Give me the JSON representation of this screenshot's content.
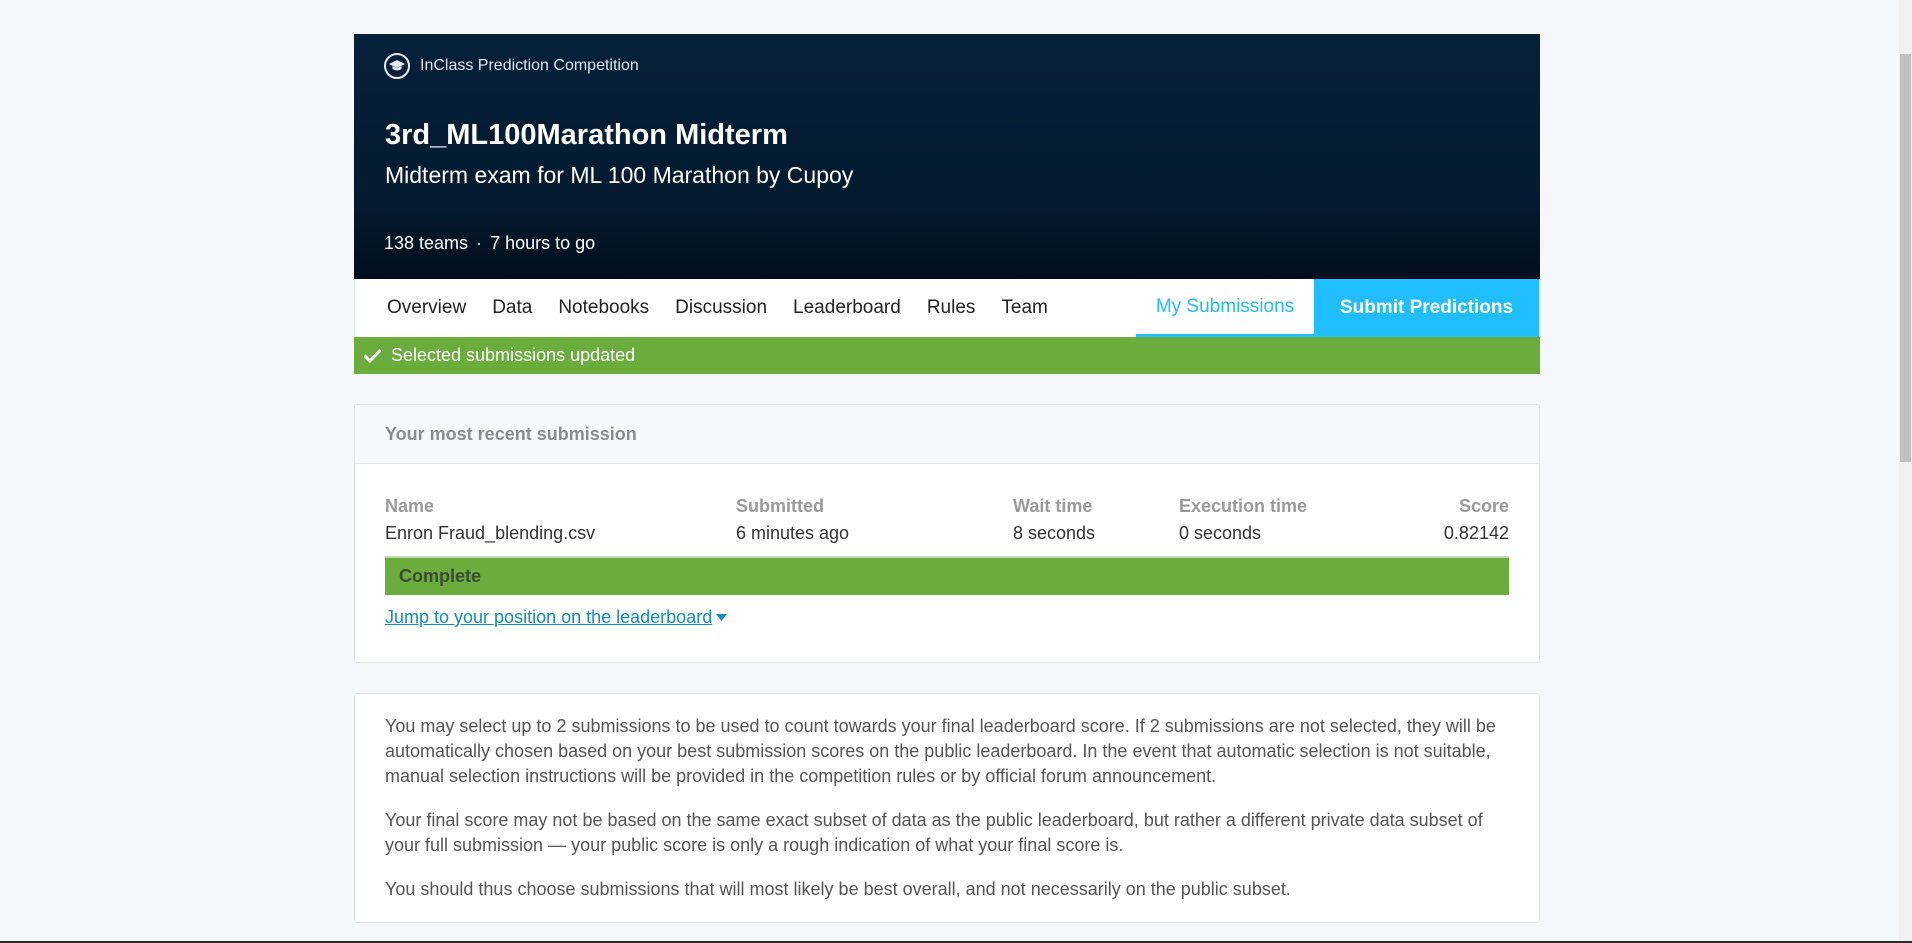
{
  "header": {
    "competition_type": "InClass Prediction Competition",
    "competition_icon": "graduation-cap-icon",
    "title": "3rd_ML100Marathon Midterm",
    "subtitle": "Midterm exam for ML 100 Marathon by Cupoy",
    "teams": "138 teams",
    "separator": "·",
    "time_left": "7 hours to go"
  },
  "nav": {
    "tabs": [
      {
        "label": "Overview"
      },
      {
        "label": "Data"
      },
      {
        "label": "Notebooks"
      },
      {
        "label": "Discussion"
      },
      {
        "label": "Leaderboard"
      },
      {
        "label": "Rules"
      },
      {
        "label": "Team"
      }
    ],
    "my_submissions": "My Submissions",
    "submit": "Submit Predictions"
  },
  "banner": {
    "icon": "check-icon",
    "message": "Selected submissions updated"
  },
  "recent": {
    "heading": "Your most recent submission",
    "columns": {
      "name_label": "Name",
      "name_value": "Enron Fraud_blending.csv",
      "submitted_label": "Submitted",
      "submitted_value": "6 minutes ago",
      "wait_label": "Wait time",
      "wait_value": "8 seconds",
      "exec_label": "Execution time",
      "exec_value": "0 seconds",
      "score_label": "Score",
      "score_value": "0.82142"
    },
    "status": "Complete",
    "jump_link": "Jump to your position on the leaderboard"
  },
  "info": {
    "paragraphs": [
      "You may select up to 2 submissions to be used to count towards your final leaderboard score. If 2 submissions are not selected, they will be automatically chosen based on your best submission scores on the public leaderboard. In the event that automatic selection is not suitable, manual selection instructions will be provided in the competition rules or by official forum announcement.",
      "Your final score may not be based on the same exact subset of data as the public leaderboard, but rather a different private data subset of your full submission — your public score is only a rough indication of what your final score is.",
      "You should thus choose submissions that will most likely be best overall, and not necessarily on the public subset."
    ]
  },
  "colors": {
    "accent": "#20beff",
    "success": "#6aad3c",
    "header_bg": "#041a2f",
    "link": "#118cc4"
  }
}
